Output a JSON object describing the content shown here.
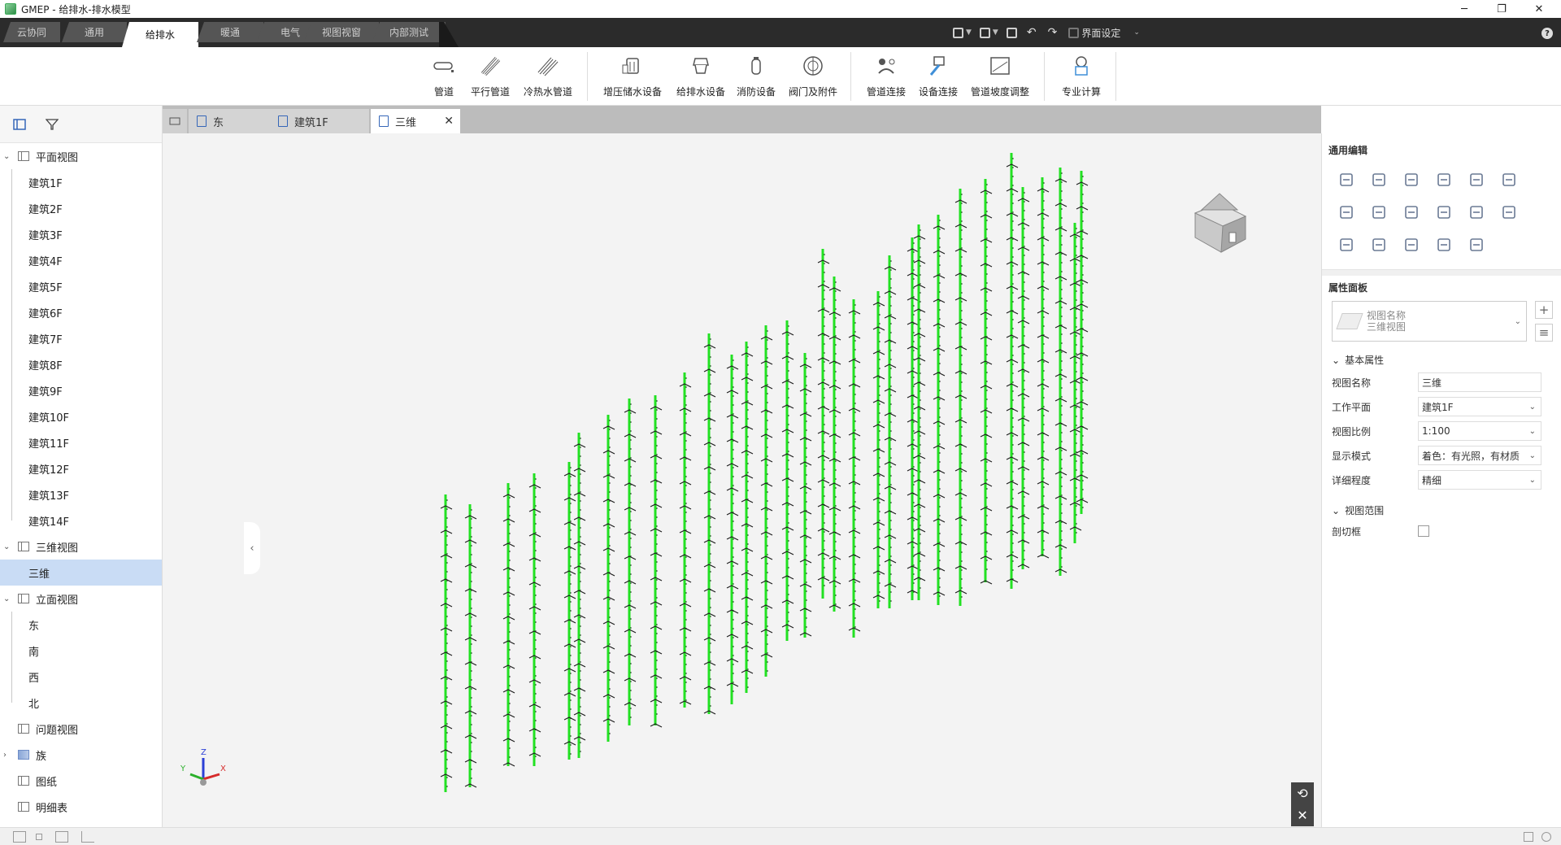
{
  "window": {
    "title": "GMEP - 给排水-排水模型",
    "minimize": "─",
    "maximize": "❐",
    "close": "✕"
  },
  "tabs": [
    {
      "label": "云协同",
      "active": false
    },
    {
      "label": "通用",
      "active": false
    },
    {
      "label": "给排水",
      "active": true
    },
    {
      "label": "暖通",
      "active": false
    },
    {
      "label": "电气",
      "active": false
    },
    {
      "label": "视图视窗",
      "active": false
    },
    {
      "label": "内部测试",
      "active": false
    }
  ],
  "quick_access": {
    "ui_settings": "界面设定"
  },
  "ribbon": [
    {
      "label": "管道",
      "icon": "pipe-icon"
    },
    {
      "label": "平行管道",
      "icon": "parallel-pipe-icon"
    },
    {
      "label": "冷热水管道",
      "icon": "hot-cold-pipe-icon"
    },
    {
      "label": "增压储水设备",
      "icon": "booster-tank-icon"
    },
    {
      "label": "给排水设备",
      "icon": "plumbing-equipment-icon"
    },
    {
      "label": "消防设备",
      "icon": "fire-equipment-icon"
    },
    {
      "label": "阀门及附件",
      "icon": "valve-icon"
    },
    {
      "label": "管道连接",
      "icon": "pipe-connect-icon"
    },
    {
      "label": "设备连接",
      "icon": "equipment-connect-icon"
    },
    {
      "label": "管道坡度调整",
      "icon": "slope-adjust-icon"
    },
    {
      "label": "专业计算",
      "icon": "calculation-icon"
    }
  ],
  "tree": {
    "plan_views": "平面视图",
    "floors": [
      "建筑1F",
      "建筑2F",
      "建筑3F",
      "建筑4F",
      "建筑5F",
      "建筑6F",
      "建筑7F",
      "建筑8F",
      "建筑9F",
      "建筑10F",
      "建筑11F",
      "建筑12F",
      "建筑13F",
      "建筑14F"
    ],
    "three_d_views": "三维视图",
    "three_d_item": "三维",
    "elevation_views": "立面视图",
    "elevations": [
      "东",
      "南",
      "西",
      "北"
    ],
    "issue_views": "问题视图",
    "families": "族",
    "sheets": "图纸",
    "schedules": "明细表"
  },
  "view_tabs": [
    {
      "label": "东",
      "active": false
    },
    {
      "label": "建筑1F",
      "active": false
    },
    {
      "label": "三维",
      "active": true
    }
  ],
  "axes": {
    "x": "X",
    "y": "Y",
    "z": "Z"
  },
  "right_panel": {
    "general_edit": "通用编辑",
    "properties_panel": "属性面板",
    "view_selector": {
      "line1": "视图名称",
      "line2": "三维视图"
    },
    "basic_props": "基本属性",
    "props": [
      {
        "label": "视图名称",
        "value": "三维",
        "dropdown": false
      },
      {
        "label": "工作平面",
        "value": "建筑1F",
        "dropdown": true
      },
      {
        "label": "视图比例",
        "value": "1:100",
        "dropdown": true
      },
      {
        "label": "显示模式",
        "value": "着色：有光照，有材质",
        "dropdown": true
      },
      {
        "label": "详细程度",
        "value": "精细",
        "dropdown": true
      }
    ],
    "view_range": "视图范围",
    "section_box": "剖切框"
  },
  "colors": {
    "pipe": "#22e122",
    "tab_bar": "#2b2b2b",
    "selection": "#c9dcf5"
  }
}
